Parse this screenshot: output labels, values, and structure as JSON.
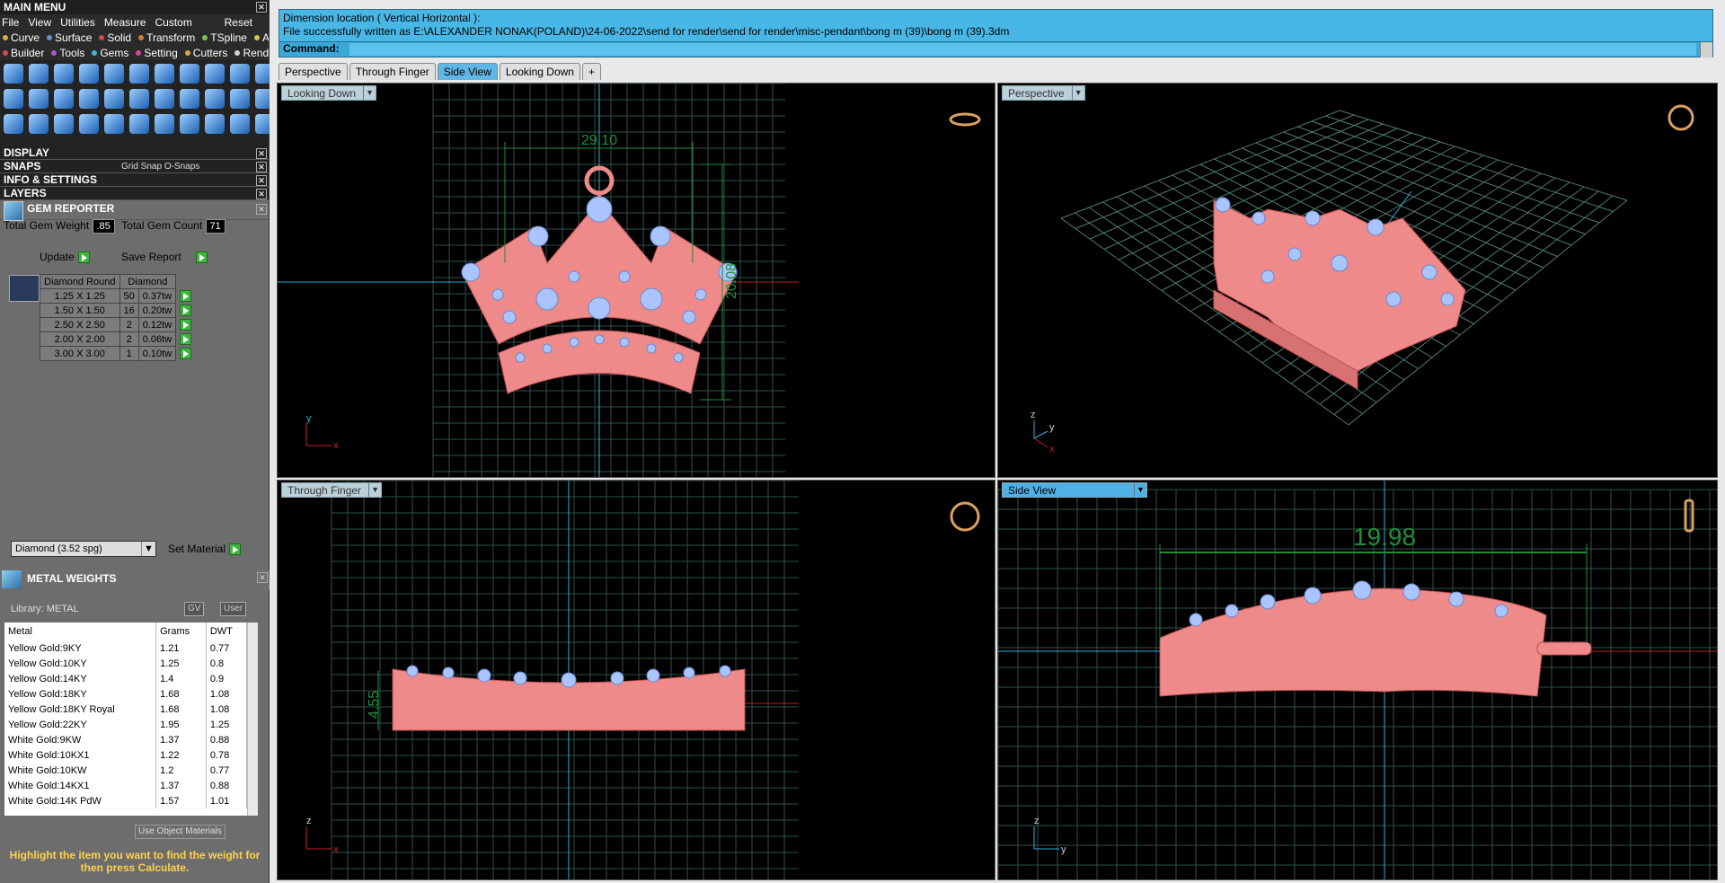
{
  "main_menu": {
    "title": "MAIN MENU",
    "menu": [
      "File",
      "View",
      "Utilities",
      "Measure",
      "Custom"
    ],
    "reset": "Reset",
    "categories_row1": [
      {
        "label": "Curve",
        "color": "#d4b33a"
      },
      {
        "label": "Surface",
        "color": "#5a9ad4"
      },
      {
        "label": "Solid",
        "color": "#d44a4a"
      },
      {
        "label": "Transform",
        "color": "#d47a2a"
      },
      {
        "label": "TSpline",
        "color": "#7ac44a"
      },
      {
        "label": "Art",
        "color": "#d4c44a"
      }
    ],
    "categories_row2": [
      {
        "label": "Builder",
        "color": "#d44a4a"
      },
      {
        "label": "Tools",
        "color": "#a45ad4"
      },
      {
        "label": "Gems",
        "color": "#4ab4d4"
      },
      {
        "label": "Setting",
        "color": "#d44a9a"
      },
      {
        "label": "Cutters",
        "color": "#d4a44a"
      },
      {
        "label": "Render",
        "color": "#d4d4d4"
      }
    ]
  },
  "sections": {
    "display": "DISPLAY",
    "snaps": "SNAPS",
    "grid_snap": "Grid Snap",
    "o_snaps": "O-Snaps",
    "info": "INFO & SETTINGS",
    "layers": "LAYERS"
  },
  "gem_reporter": {
    "title": "GEM REPORTER",
    "total_weight_label": "Total Gem Weight",
    "total_weight": ".85",
    "total_count_label": "Total Gem Count",
    "total_count": "71",
    "update": "Update",
    "save_report": "Save Report",
    "col_shape": "Diamond Round",
    "col_material": "Diamond",
    "rows": [
      {
        "size": "1.25 X 1.25",
        "count": "50",
        "weight": "0.37tw"
      },
      {
        "size": "1.50 X 1.50",
        "count": "16",
        "weight": "0.20tw"
      },
      {
        "size": "2.50 X 2.50",
        "count": "2",
        "weight": "0.12tw"
      },
      {
        "size": "2.00 X 2.00",
        "count": "2",
        "weight": "0.06tw"
      },
      {
        "size": "3.00 X 3.00",
        "count": "1",
        "weight": "0.10tw"
      }
    ],
    "material_select": "Diamond    (3.52 spg)",
    "set_material": "Set Material"
  },
  "metal_weights": {
    "title": "METAL WEIGHTS",
    "library": "Library: METAL",
    "gv": "GV",
    "user": "User",
    "col_metal": "Metal",
    "col_grams": "Grams",
    "col_dwt": "DWT",
    "rows": [
      {
        "metal": "Yellow Gold:9KY",
        "grams": "1.21",
        "dwt": "0.77"
      },
      {
        "metal": "Yellow Gold:10KY",
        "grams": "1.25",
        "dwt": "0.8"
      },
      {
        "metal": "Yellow Gold:14KY",
        "grams": "1.4",
        "dwt": "0.9"
      },
      {
        "metal": "Yellow Gold:18KY",
        "grams": "1.68",
        "dwt": "1.08"
      },
      {
        "metal": "Yellow Gold:18KY Royal",
        "grams": "1.68",
        "dwt": "1.08"
      },
      {
        "metal": "Yellow Gold:22KY",
        "grams": "1.95",
        "dwt": "1.25"
      },
      {
        "metal": "White Gold:9KW",
        "grams": "1.37",
        "dwt": "0.88"
      },
      {
        "metal": "White Gold:10KX1",
        "grams": "1.22",
        "dwt": "0.78"
      },
      {
        "metal": "White Gold:10KW",
        "grams": "1.2",
        "dwt": "0.77"
      },
      {
        "metal": "White Gold:14KX1",
        "grams": "1.37",
        "dwt": "0.88"
      },
      {
        "metal": "White Gold:14K PdW",
        "grams": "1.57",
        "dwt": "1.01"
      }
    ],
    "use_object": "Use Object Materials",
    "hint": "Highlight the item you want to find the weight for then press Calculate."
  },
  "command": {
    "line1": "Dimension location ( Vertical  Horizontal ):",
    "line2": "File successfully written as E:\\ALEXANDER NONAK(POLAND)\\24-06-2022\\send for render\\send for render\\misc-pendant\\bong m (39)\\bong m (39).3dm",
    "prompt": "Command:"
  },
  "tabs": [
    "Perspective",
    "Through Finger",
    "Side View",
    "Looking Down",
    "+"
  ],
  "active_tab": 2,
  "viewports": {
    "top_left": {
      "label": "Looking Down",
      "dim_w": "29.10",
      "dim_h": "20.08",
      "axis_a": "y",
      "axis_b": "x"
    },
    "top_right": {
      "label": "Perspective",
      "axis_a": "z",
      "axis_b": "y",
      "axis_c": "x"
    },
    "bottom_left": {
      "label": "Through Finger",
      "dim_h": "4.55",
      "axis_a": "z",
      "axis_b": "x"
    },
    "bottom_right": {
      "label": "Side View",
      "dim_w": "19.98",
      "axis_a": "z",
      "axis_b": "y"
    }
  },
  "colors": {
    "model": "#ee8a8a",
    "gem": "#a9c4ff",
    "grid": "#2f4f4a",
    "dimension": "#1f8f3a",
    "axis": "#2fb0d0"
  }
}
